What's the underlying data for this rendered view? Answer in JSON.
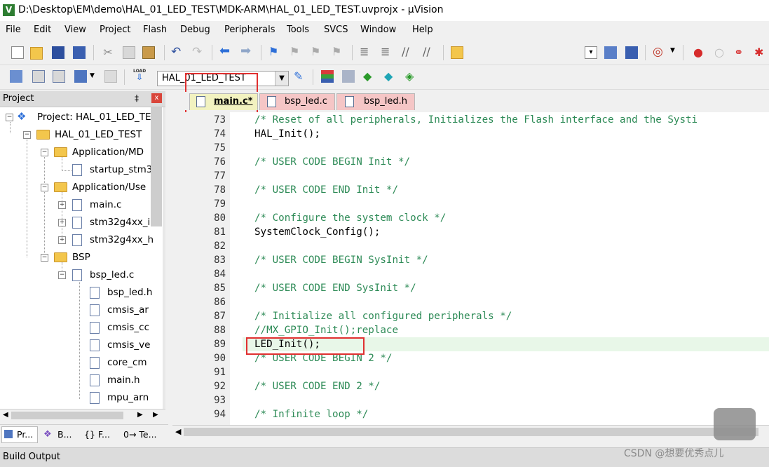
{
  "window": {
    "title": "D:\\Desktop\\EM\\demo\\HAL_01_LED_TEST\\MDK-ARM\\HAL_01_LED_TEST.uvprojx - µVision",
    "logo": "V"
  },
  "menu": [
    "File",
    "Edit",
    "View",
    "Project",
    "Flash",
    "Debug",
    "Peripherals",
    "Tools",
    "SVCS",
    "Window",
    "Help"
  ],
  "toolbar": {
    "target": "HAL_01_LED_TEST",
    "load_label": "LOAD"
  },
  "project_panel": {
    "title": "Project",
    "pin": "‡",
    "close": "x",
    "tree": [
      {
        "label": "Project: HAL_01_LED_TE"
      },
      {
        "label": "HAL_01_LED_TEST"
      },
      {
        "label": "Application/MD"
      },
      {
        "label": "startup_stm3"
      },
      {
        "label": "Application/Use"
      },
      {
        "label": "main.c"
      },
      {
        "label": "stm32g4xx_i"
      },
      {
        "label": "stm32g4xx_h"
      },
      {
        "label": "BSP"
      },
      {
        "label": "bsp_led.c"
      },
      {
        "label": "bsp_led.h"
      },
      {
        "label": "cmsis_ar"
      },
      {
        "label": "cmsis_cc"
      },
      {
        "label": "cmsis_ve"
      },
      {
        "label": "core_cm"
      },
      {
        "label": "main.h"
      },
      {
        "label": "mpu_arn"
      }
    ],
    "bottom_tabs": [
      "Pr...",
      "B...",
      "{} F...",
      "0→ Te..."
    ]
  },
  "editor_tabs": [
    {
      "label": "main.c*"
    },
    {
      "label": "bsp_led.c"
    },
    {
      "label": "bsp_led.h"
    }
  ],
  "code_lines": [
    {
      "num": "73",
      "text": "/* Reset of all peripherals, Initializes the Flash interface and the Systi",
      "comment": true
    },
    {
      "num": "74",
      "text": "HAL_Init();",
      "comment": false
    },
    {
      "num": "75",
      "text": "",
      "comment": false
    },
    {
      "num": "76",
      "text": "/* USER CODE BEGIN Init */",
      "comment": true
    },
    {
      "num": "77",
      "text": "",
      "comment": false
    },
    {
      "num": "78",
      "text": "/* USER CODE END Init */",
      "comment": true
    },
    {
      "num": "79",
      "text": "",
      "comment": false
    },
    {
      "num": "80",
      "text": "/* Configure the system clock */",
      "comment": true
    },
    {
      "num": "81",
      "text": "SystemClock_Config();",
      "comment": false
    },
    {
      "num": "82",
      "text": "",
      "comment": false
    },
    {
      "num": "83",
      "text": "/* USER CODE BEGIN SysInit */",
      "comment": true
    },
    {
      "num": "84",
      "text": "",
      "comment": false
    },
    {
      "num": "85",
      "text": "/* USER CODE END SysInit */",
      "comment": true
    },
    {
      "num": "86",
      "text": "",
      "comment": false
    },
    {
      "num": "87",
      "text": "/* Initialize all configured peripherals */",
      "comment": true
    },
    {
      "num": "88",
      "text": "//MX_GPIO_Init();replace",
      "comment": true
    },
    {
      "num": "89",
      "text": "LED_Init();",
      "comment": false
    },
    {
      "num": "90",
      "text": "/* USER CODE BEGIN 2 */",
      "comment": true
    },
    {
      "num": "91",
      "text": "",
      "comment": false
    },
    {
      "num": "92",
      "text": "/* USER CODE END 2 */",
      "comment": true
    },
    {
      "num": "93",
      "text": "",
      "comment": false
    },
    {
      "num": "94",
      "text": "/* Infinite loop */",
      "comment": true
    }
  ],
  "build_output": {
    "title": "Build Output"
  },
  "watermark": "CSDN @想要优秀点儿",
  "colors": {
    "comment": "#2e8b57",
    "highlight": "#e8f7e8",
    "annotation": "#e03030",
    "main_tab": "#f2f2c0",
    "other_tabs": "#f5c6c6"
  }
}
